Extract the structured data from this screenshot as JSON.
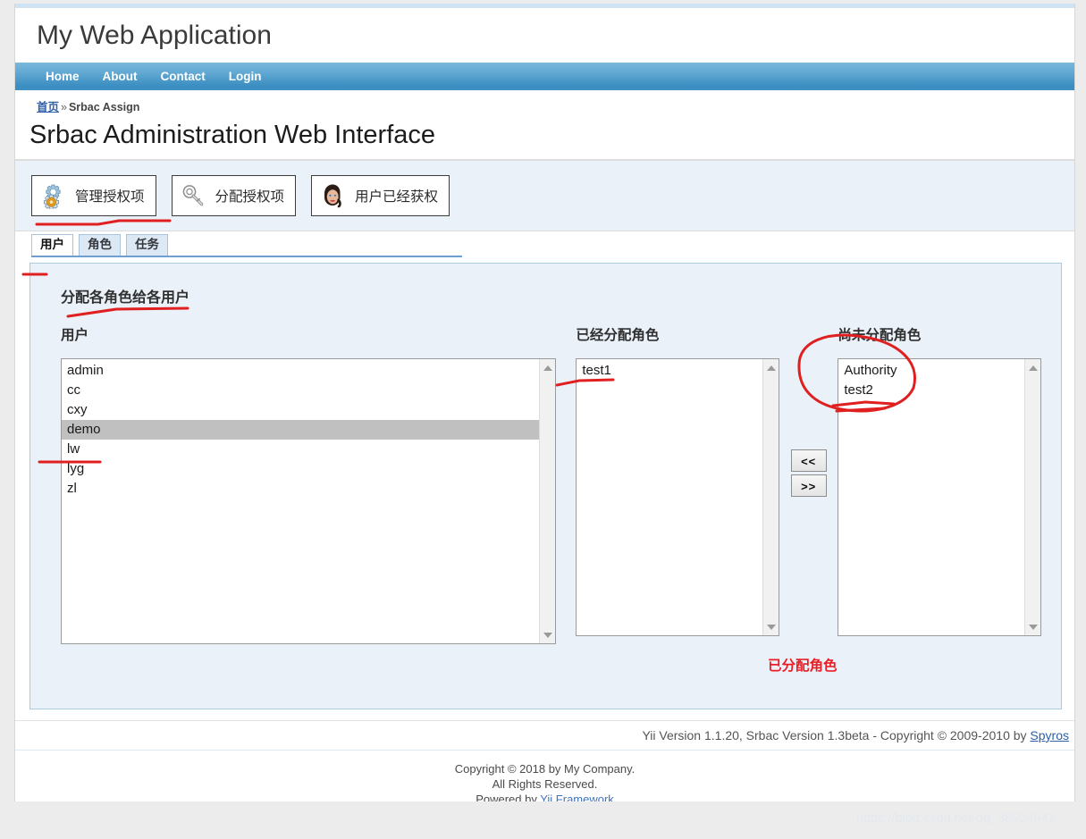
{
  "header": {
    "app_title": "My Web Application"
  },
  "nav": {
    "items": [
      {
        "label": "Home"
      },
      {
        "label": "About"
      },
      {
        "label": "Contact"
      },
      {
        "label": "Login"
      }
    ]
  },
  "breadcrumb": {
    "home_label": "首页",
    "separator": "»",
    "current": "Srbac Assign"
  },
  "page": {
    "title": "Srbac Administration Web Interface"
  },
  "toolbar": {
    "buttons": [
      {
        "label": "管理授权项",
        "icon": "gear-icon"
      },
      {
        "label": "分配授权项",
        "icon": "key-icon"
      },
      {
        "label": "用户已经获权",
        "icon": "user-avatar-icon"
      }
    ]
  },
  "tabs": [
    {
      "label": "用户",
      "active": true
    },
    {
      "label": "角色",
      "active": false
    },
    {
      "label": "任务",
      "active": false
    }
  ],
  "panel": {
    "title": "分配各角色给各用户",
    "users": {
      "label": "用户",
      "items": [
        {
          "label": "admin",
          "selected": false
        },
        {
          "label": "cc",
          "selected": false
        },
        {
          "label": "cxy",
          "selected": false
        },
        {
          "label": "demo",
          "selected": true
        },
        {
          "label": "lw",
          "selected": false
        },
        {
          "label": "lyg",
          "selected": false
        },
        {
          "label": "zl",
          "selected": false
        }
      ]
    },
    "assigned": {
      "label": "已经分配角色",
      "items": [
        {
          "label": "test1",
          "selected": false
        }
      ]
    },
    "unassigned": {
      "label": "尚未分配角色",
      "items": [
        {
          "label": "Authority",
          "selected": false
        },
        {
          "label": "test2",
          "selected": false
        }
      ]
    },
    "transfer": {
      "move_left_label": "<<",
      "move_right_label": ">>"
    },
    "annotation": {
      "text": "已分配角色",
      "color": "#ec1c24"
    }
  },
  "srbac_footer": {
    "text": "Yii Version 1.1.20,  Srbac Version 1.3beta - Copyright © 2009-2010 by ",
    "link_label": "Spyros"
  },
  "site_footer": {
    "line1": "Copyright © 2018 by My Company.",
    "line2": "All Rights Reserved.",
    "line3_prefix": "Powered by ",
    "line3_link": "Yii Framework"
  },
  "watermark": {
    "text": "https://blog.csdn.net/qq_38924942"
  },
  "colors": {
    "nav_gradient_top": "#79b8dd",
    "nav_gradient_bottom": "#3f90c2",
    "panel_bg": "#eaf1f9",
    "panel_border": "#a8cbe6",
    "toolbar_band_bg": "#ebf1f8",
    "tab_inactive_bg": "#dce8f4",
    "selection_bg": "#c0c0c0",
    "annotation_red": "#ec1c24"
  }
}
